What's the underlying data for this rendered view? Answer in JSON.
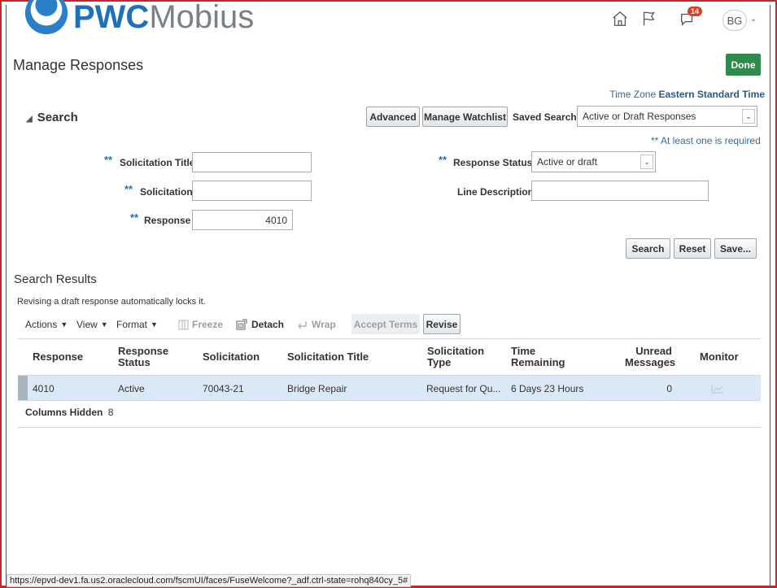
{
  "header": {
    "logo_bold": "PWC",
    "logo_light": "Mobius",
    "notification_count": "14",
    "user_initials": "BG",
    "icons": [
      "home-icon",
      "flag-icon",
      "notifications-icon",
      "chevron-down-icon"
    ]
  },
  "page": {
    "title": "Manage Responses",
    "done_label": "Done",
    "timezone_label": "Time Zone",
    "timezone_value": "Eastern Standard Time"
  },
  "search": {
    "title": "Search",
    "advanced_label": "Advanced",
    "watchlist_label": "Manage Watchlist",
    "saved_search_label": "Saved Search",
    "saved_search_value": "Active or Draft Responses",
    "required_note": "** At least one is required",
    "required_marker": "**",
    "fields": {
      "solicitation_title_label": "Solicitation Title",
      "solicitation_title_value": "",
      "solicitation_label": "Solicitation",
      "solicitation_value": "",
      "response_label": "Response",
      "response_value": "4010",
      "response_status_label": "Response Status",
      "response_status_value": "Active or draft",
      "line_description_label": "Line Description",
      "line_description_value": ""
    },
    "search_button": "Search",
    "reset_button": "Reset",
    "save_button": "Save..."
  },
  "results": {
    "title": "Search Results",
    "note": "Revising a draft response automatically locks it.",
    "toolbar": {
      "actions": "Actions",
      "view": "View",
      "format": "Format",
      "freeze": "Freeze",
      "detach": "Detach",
      "wrap": "Wrap",
      "accept_terms": "Accept Terms",
      "revise": "Revise"
    },
    "columns": [
      {
        "line1": "Response",
        "line2": ""
      },
      {
        "line1": "Response",
        "line2": "Status"
      },
      {
        "line1": "Solicitation",
        "line2": ""
      },
      {
        "line1": "Solicitation Title",
        "line2": ""
      },
      {
        "line1": "Solicitation",
        "line2": "Type"
      },
      {
        "line1": "Time",
        "line2": "Remaining"
      },
      {
        "line1": "Unread",
        "line2": "Messages"
      },
      {
        "line1": "Monitor",
        "line2": ""
      }
    ],
    "rows": [
      {
        "response": "4010",
        "status": "Active",
        "solicitation": "70043-21",
        "title": "Bridge Repair",
        "type": "Request for Qu...",
        "time_remaining": "6 Days 23 Hours",
        "unread": "0",
        "monitor_icon": "monitor-chart-icon"
      }
    ],
    "columns_hidden_label": "Columns Hidden",
    "columns_hidden_count": "8"
  },
  "status_bar": {
    "url": "https://epvd-dev1.fa.us2.oraclecloud.com/fscmUI/faces/FuseWelcome?_adf.ctrl-state=rohq840cy_5#"
  },
  "colors": {
    "brand_blue": "#1f6fba",
    "done_green": "#2f8a4c",
    "selected_row": "#dbe9f6",
    "badge_red": "#d2422b"
  }
}
